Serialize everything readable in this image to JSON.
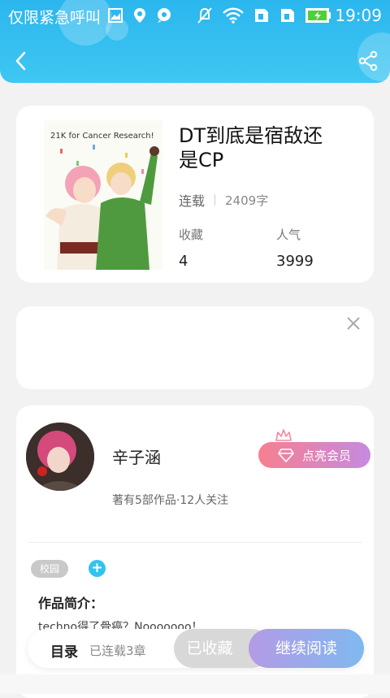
{
  "status_bar": {
    "carrier_text": "仅限紧急呼叫",
    "time": "19:09",
    "icons_left": [
      "image-icon",
      "location-icon",
      "message-icon"
    ],
    "icons_right": [
      "mute-icon",
      "wifi-icon",
      "sim-icon",
      "sim-icon",
      "battery-icon"
    ]
  },
  "header": {
    "back_icon": "back-icon",
    "share_icon": "share-icon",
    "accent": "#2bb6ee"
  },
  "book": {
    "cover_text": "21K for Cancer Research!",
    "title": "DT到底是宿敌还是CP",
    "status": "连载",
    "word_count": "2409字",
    "stats": [
      {
        "label": "收藏",
        "value": "4"
      },
      {
        "label": "人气",
        "value": "3999"
      }
    ]
  },
  "ad": {
    "close_icon": "close-icon"
  },
  "author": {
    "name": "辛子涵",
    "vip_button": "点亮会员",
    "meta": "著有5部作品·12人关注",
    "tags": [
      "校园"
    ],
    "intro_title": "作品简介：",
    "intro_text": "techno得了骨癌？Nooooooo！"
  },
  "bottom_bar": {
    "toc_label": "目录",
    "chapters": "已连载3章",
    "collected_label": "已收藏",
    "read_label": "继续阅读"
  }
}
